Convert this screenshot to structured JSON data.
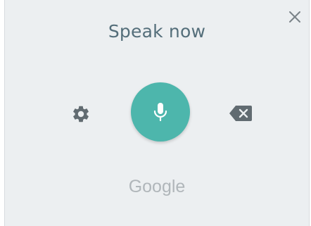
{
  "dialog": {
    "title": "Speak now",
    "brand": "Google"
  },
  "icons": {
    "close": "close-icon",
    "settings": "gear-icon",
    "mic": "microphone-icon",
    "backspace": "backspace-icon"
  },
  "colors": {
    "background": "#eceff1",
    "accent": "#4db6ac",
    "title_text": "#546e7a",
    "icon_gray": "#616b71",
    "brand_text": "#b0b6ba"
  }
}
